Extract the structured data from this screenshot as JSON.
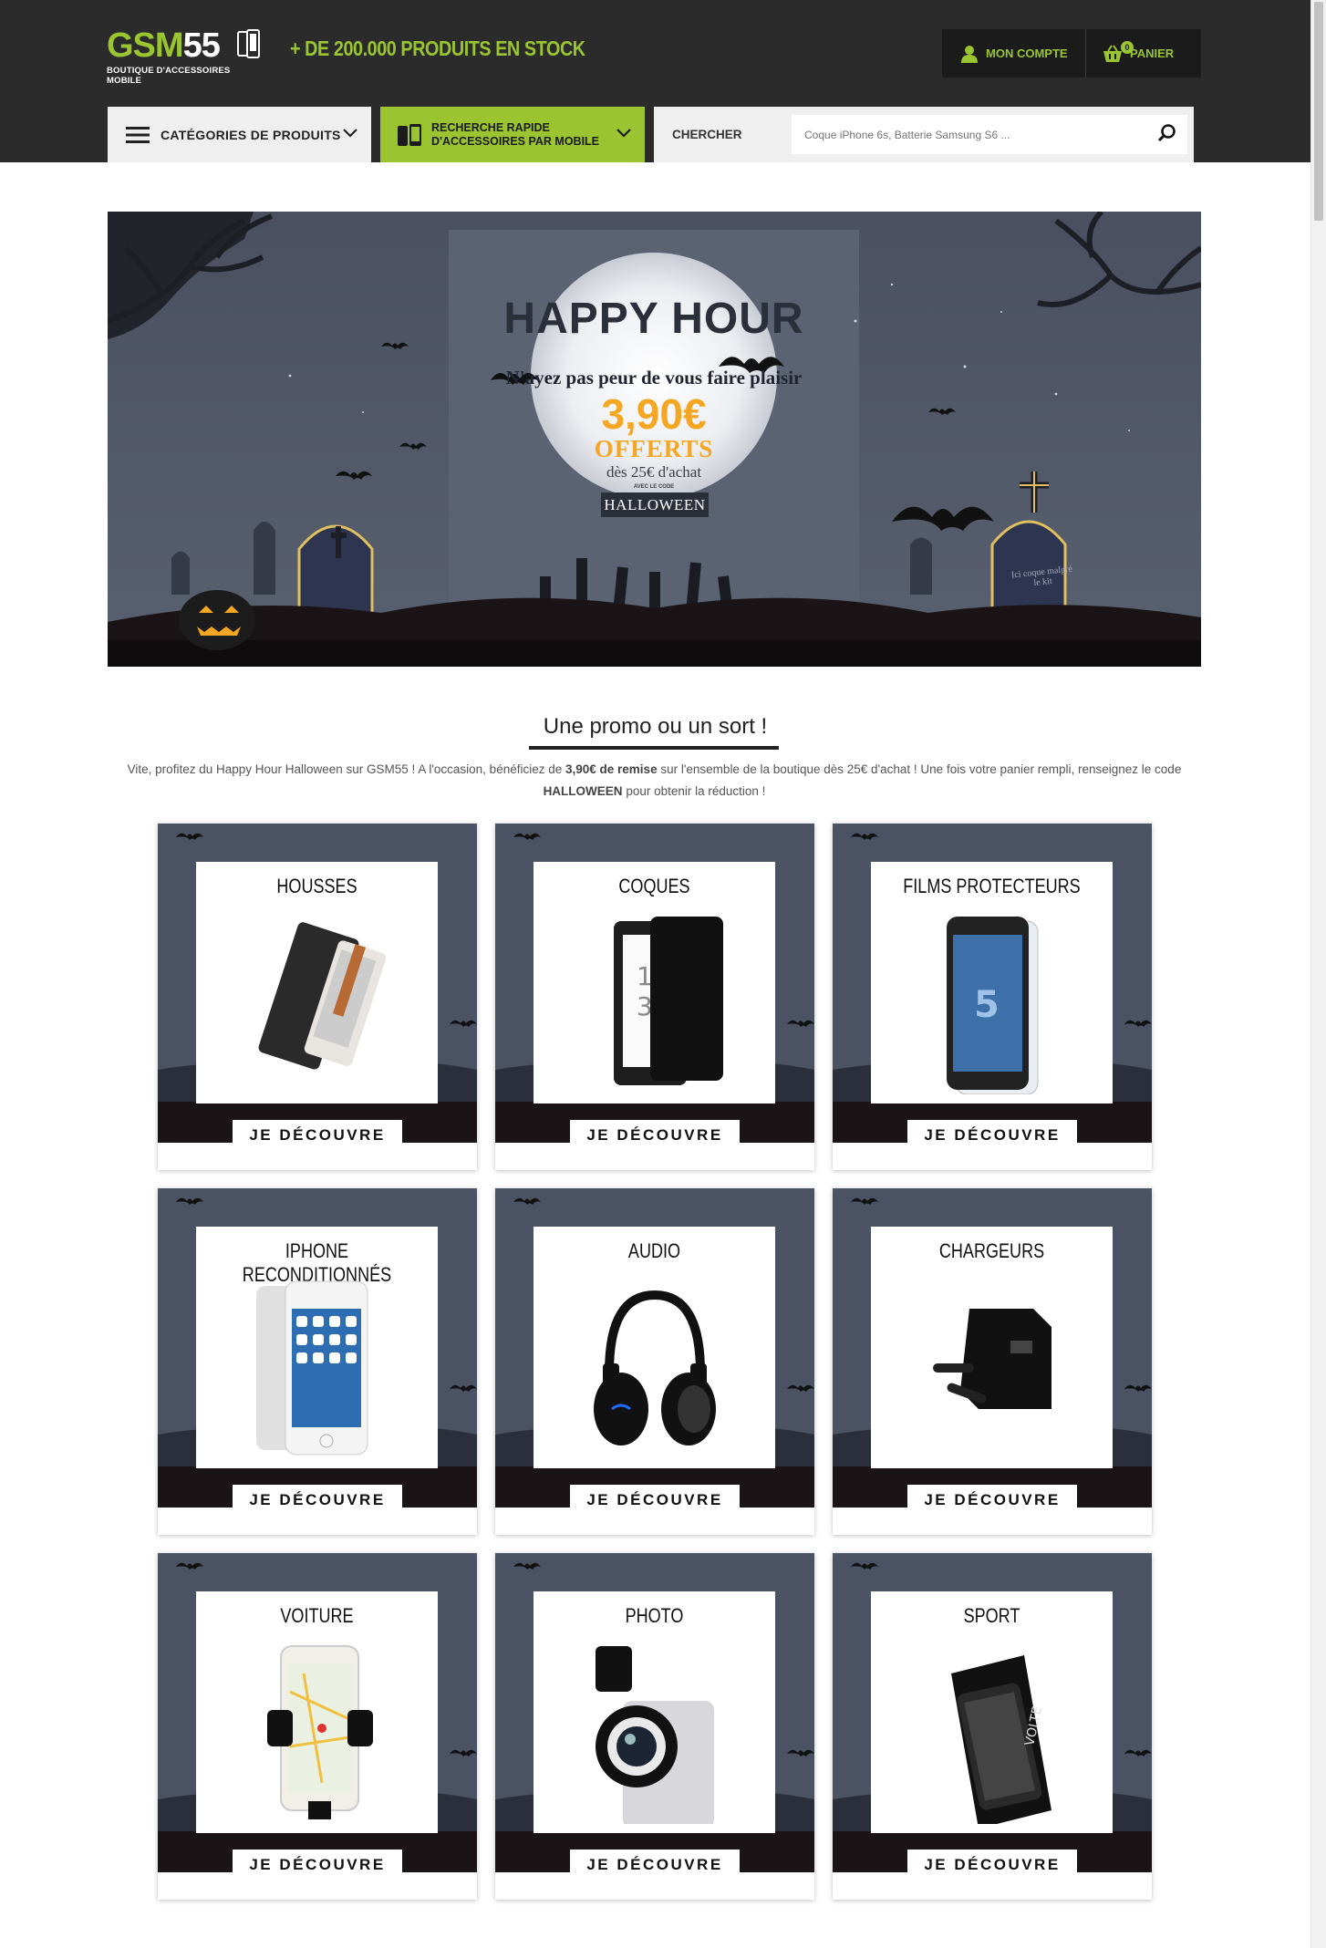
{
  "header": {
    "logo": {
      "part1": "GSM",
      "part2": "55",
      "subtitle": "BOUTIQUE D'ACCESSOIRES MOBILE"
    },
    "tagline": "+ DE 200.000 PRODUITS EN STOCK",
    "account_label": "MON COMPTE",
    "cart_label": "PANIER",
    "cart_count": "0"
  },
  "nav": {
    "categories_label": "CATÉGORIES DE PRODUITS",
    "quick_search_label": "RECHERCHE RAPIDE D'ACCESSOIRES PAR MOBILE",
    "search_label": "CHERCHER",
    "search_placeholder": "Coque iPhone 6s, Batterie Samsung S6 ..."
  },
  "banner": {
    "title": "HAPPY HOUR",
    "subtitle": "N'ayez pas peur de vous faire plaisir",
    "price": "3,90€",
    "offered": "OFFERTS",
    "minimum": "dès 25€ d'achat",
    "code_label": "AVEC LE CODE",
    "code": "HALLOWEEN",
    "tomb_text_right": "Ici coque malgré le kit"
  },
  "promo": {
    "title": "Une promo ou un sort !",
    "text_1": "Vite, profitez du Happy Hour Halloween sur GSM55 ! A l'occasion, bénéficiez de ",
    "text_bold_1": "3,90€ de remise",
    "text_2": " sur l'ensemble de la boutique dès 25€ d'achat ! Une fois votre panier rempli, renseignez le code ",
    "text_bold_2": "HALLOWEEN",
    "text_3": " pour obtenir la réduction !"
  },
  "cta_label": "JE DÉCOUVRE",
  "categories": [
    {
      "title": "HOUSSES",
      "icon": "wallet-case-icon"
    },
    {
      "title": "COQUES",
      "icon": "phone-case-icon"
    },
    {
      "title": "FILMS PROTECTEURS",
      "icon": "screen-protector-icon"
    },
    {
      "title": "IPHONE RECONDITIONNÉS",
      "icon": "iphone-icon"
    },
    {
      "title": "AUDIO",
      "icon": "headphones-icon"
    },
    {
      "title": "CHARGEURS",
      "icon": "charger-icon"
    },
    {
      "title": "VOITURE",
      "icon": "car-holder-icon"
    },
    {
      "title": "PHOTO",
      "icon": "clip-lens-icon"
    },
    {
      "title": "SPORT",
      "icon": "armband-icon"
    }
  ],
  "colors": {
    "brand_green": "#9ac531",
    "header_dark": "#2b2b2b",
    "card_slate": "#4a5263",
    "pumpkin_orange": "#f5a623"
  }
}
